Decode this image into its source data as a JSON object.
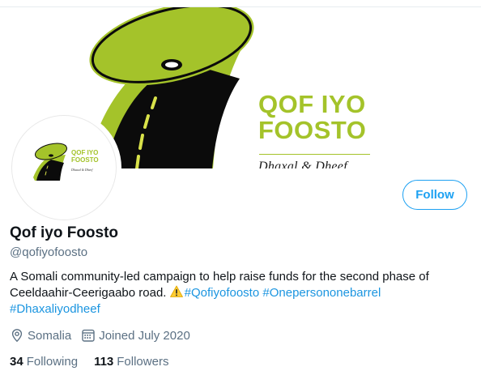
{
  "banner": {
    "logo_line1": "QOF IYO",
    "logo_line2": "FOOSTO",
    "logo_tagline": "Dhaxal & Dheef"
  },
  "avatar": {
    "logo_line1": "QOF IYO",
    "logo_line2": "FOOSTO",
    "logo_tagline": "Dhaxal & Dheef"
  },
  "profile": {
    "name": "Qof iyo Foosto",
    "handle": "@qofiyofoosto",
    "bio_text": "A Somali community-led campaign to help raise funds for the second phase of Ceeldaahir-Ceerigaabo road.",
    "hashtags": [
      "#Qofiyofoosto",
      "#Onepersononebarrel",
      "#Dhaxaliyodheef"
    ],
    "location": "Somalia",
    "joined": "Joined July 2020",
    "following_count": "34",
    "following_label": "Following",
    "followers_count": "113",
    "followers_label": "Followers"
  },
  "actions": {
    "follow_label": "Follow"
  },
  "icons": {
    "location": "location-pin-icon",
    "calendar": "calendar-icon",
    "warning": "warning-emoji-icon"
  },
  "colors": {
    "brand_green": "#a4c32a",
    "link_blue": "#1b95e0",
    "follow_blue": "#1da1f2",
    "secondary_text": "#5b7083"
  }
}
